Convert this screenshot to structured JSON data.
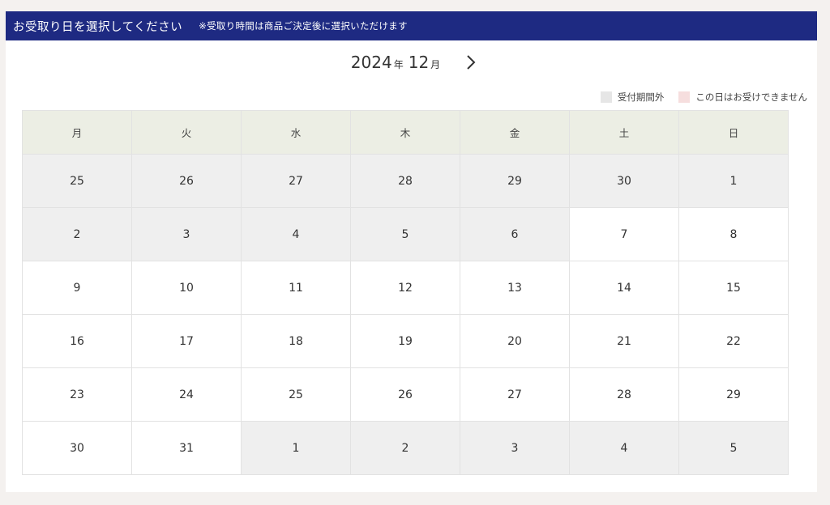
{
  "header": {
    "title": "お受取り日を選択してください",
    "note": "※受取り時間は商品ご決定後に選択いただけます"
  },
  "month_nav": {
    "year": "2024",
    "year_unit": "年",
    "month": "12",
    "month_unit": "月",
    "next_icon": "chevron-right-icon"
  },
  "legend": [
    {
      "label": "受付期間外",
      "color": "#e6e6e6"
    },
    {
      "label": "この日はお受けできません",
      "color": "#f6dede"
    }
  ],
  "colors": {
    "header_bg": "#1e2a82",
    "weekday_bg": "#eceee4",
    "out_of_period_bg": "#efefef"
  },
  "weekdays": [
    "月",
    "火",
    "水",
    "木",
    "金",
    "土",
    "日"
  ],
  "weeks": [
    [
      {
        "d": "25",
        "s": "out"
      },
      {
        "d": "26",
        "s": "out"
      },
      {
        "d": "27",
        "s": "out"
      },
      {
        "d": "28",
        "s": "out"
      },
      {
        "d": "29",
        "s": "out"
      },
      {
        "d": "30",
        "s": "out"
      },
      {
        "d": "1",
        "s": "out"
      }
    ],
    [
      {
        "d": "2",
        "s": "out"
      },
      {
        "d": "3",
        "s": "out"
      },
      {
        "d": "4",
        "s": "out"
      },
      {
        "d": "5",
        "s": "out"
      },
      {
        "d": "6",
        "s": "out"
      },
      {
        "d": "7",
        "s": "ok"
      },
      {
        "d": "8",
        "s": "ok"
      }
    ],
    [
      {
        "d": "9",
        "s": "ok"
      },
      {
        "d": "10",
        "s": "ok"
      },
      {
        "d": "11",
        "s": "ok"
      },
      {
        "d": "12",
        "s": "ok"
      },
      {
        "d": "13",
        "s": "ok"
      },
      {
        "d": "14",
        "s": "ok"
      },
      {
        "d": "15",
        "s": "ok"
      }
    ],
    [
      {
        "d": "16",
        "s": "ok"
      },
      {
        "d": "17",
        "s": "ok"
      },
      {
        "d": "18",
        "s": "ok"
      },
      {
        "d": "19",
        "s": "ok"
      },
      {
        "d": "20",
        "s": "ok"
      },
      {
        "d": "21",
        "s": "ok"
      },
      {
        "d": "22",
        "s": "ok"
      }
    ],
    [
      {
        "d": "23",
        "s": "ok"
      },
      {
        "d": "24",
        "s": "ok"
      },
      {
        "d": "25",
        "s": "ok"
      },
      {
        "d": "26",
        "s": "ok"
      },
      {
        "d": "27",
        "s": "ok"
      },
      {
        "d": "28",
        "s": "ok"
      },
      {
        "d": "29",
        "s": "ok"
      }
    ],
    [
      {
        "d": "30",
        "s": "ok"
      },
      {
        "d": "31",
        "s": "ok"
      },
      {
        "d": "1",
        "s": "out"
      },
      {
        "d": "2",
        "s": "out"
      },
      {
        "d": "3",
        "s": "out"
      },
      {
        "d": "4",
        "s": "out"
      },
      {
        "d": "5",
        "s": "out"
      }
    ]
  ]
}
